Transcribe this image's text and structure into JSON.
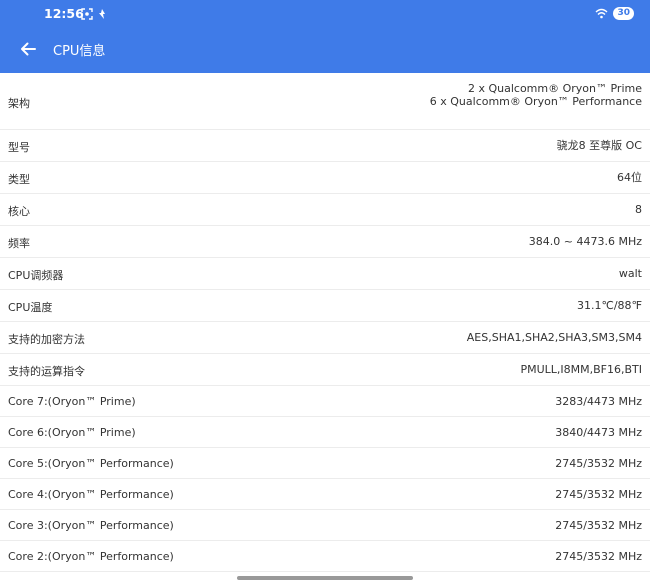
{
  "status_bar": {
    "time": "12:56",
    "battery": "30"
  },
  "header": {
    "title": "CPU信息",
    "accent_color": "#3f7be8"
  },
  "info_rows": [
    {
      "label": "架构",
      "value_line1": "2 x Qualcomm® Oryon™ Prime",
      "value_line2": "6 x Qualcomm® Oryon™ Performance"
    },
    {
      "label": "型号",
      "value": "骁龙8 至尊版 OC"
    },
    {
      "label": "类型",
      "value": "64位"
    },
    {
      "label": "核心",
      "value": "8"
    },
    {
      "label": "频率",
      "value": "384.0 ~ 4473.6 MHz"
    },
    {
      "label": "CPU调频器",
      "value": "walt"
    },
    {
      "label": "CPU温度",
      "value": "31.1℃/88℉"
    },
    {
      "label": "支持的加密方法",
      "value": "AES,SHA1,SHA2,SHA3,SM3,SM4"
    },
    {
      "label": "支持的运算指令",
      "value": "PMULL,I8MM,BF16,BTI"
    }
  ],
  "cores": [
    {
      "label": "Core 7:(Oryon™ Prime)",
      "value": "3283/4473 MHz"
    },
    {
      "label": "Core 6:(Oryon™ Prime)",
      "value": "3840/4473 MHz"
    },
    {
      "label": "Core 5:(Oryon™ Performance)",
      "value": "2745/3532 MHz"
    },
    {
      "label": "Core 4:(Oryon™ Performance)",
      "value": "2745/3532 MHz"
    },
    {
      "label": "Core 3:(Oryon™ Performance)",
      "value": "2745/3532 MHz"
    },
    {
      "label": "Core 2:(Oryon™ Performance)",
      "value": "2745/3532 MHz"
    }
  ]
}
